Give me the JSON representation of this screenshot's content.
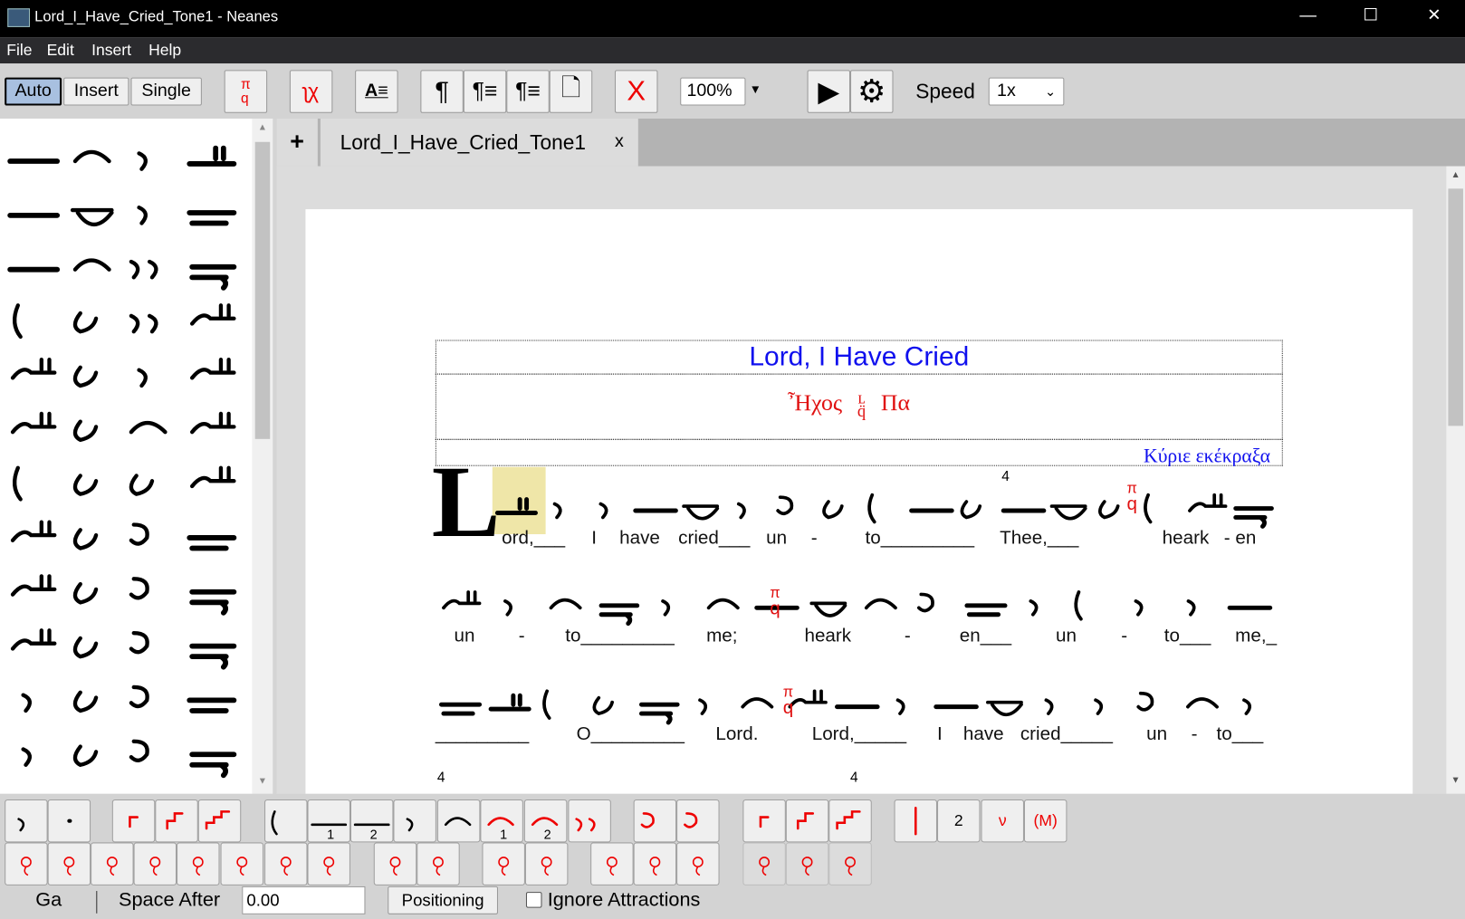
{
  "window": {
    "title": "Lord_I_Have_Cried_Tone1 - Neanes",
    "controls": [
      "minimize-icon",
      "maximize-icon",
      "close-icon"
    ]
  },
  "menu": [
    "File",
    "Edit",
    "Insert",
    "Help"
  ],
  "toolbar": {
    "modes": [
      {
        "label": "Auto",
        "selected": true
      },
      {
        "label": "Insert",
        "selected": false
      },
      {
        "label": "Single",
        "selected": false
      }
    ],
    "icons": [
      "martyria-icon",
      "tempo-icon",
      "lyrics-format-icon",
      "paragraph-icon",
      "paragraph-left-icon",
      "paragraph-right-icon",
      "page-break-icon",
      "delete-icon",
      "play-icon",
      "settings-icon"
    ],
    "zoom": "100%",
    "speed_label": "Speed",
    "speed": "1x",
    "delete_glyph": "X"
  },
  "tabs": {
    "add": "+",
    "items": [
      {
        "label": "Lord_I_Have_Cried_Tone1",
        "close": "x"
      }
    ]
  },
  "score": {
    "title": "Lord, I Have Cried",
    "title_color": "#1010ee",
    "mode": "Ἦχος",
    "mode_suffix": "Πα",
    "mode_color": "#e01010",
    "header_right": "Κύριε εκέκραξα",
    "drop_cap": "L",
    "time_marks": [
      "4",
      "4",
      "4"
    ],
    "lines": [
      [
        "ord,___",
        "I",
        "have",
        "cried___",
        "un",
        "-",
        "to_________",
        "Thee,___",
        "heark",
        "- en"
      ],
      [
        "un",
        "-",
        "to_________",
        "me;",
        "heark",
        "-",
        "en___",
        "un",
        "-",
        "to___",
        "me,_"
      ],
      [
        "_________",
        "O_________",
        "Lord.",
        "Lord,_____",
        "I",
        "have",
        "cried_____",
        "un",
        "-",
        "to___"
      ]
    ]
  },
  "bottom": {
    "status": "Ga",
    "space_after_label": "Space After",
    "space_after": "0.00",
    "positioning": "Positioning",
    "ignore_attractions": "Ignore Attractions",
    "ignore_attractions_checked": false,
    "button_labels": {
      "num1": "1",
      "num2": "2",
      "two": "2",
      "m": "(M)"
    }
  }
}
